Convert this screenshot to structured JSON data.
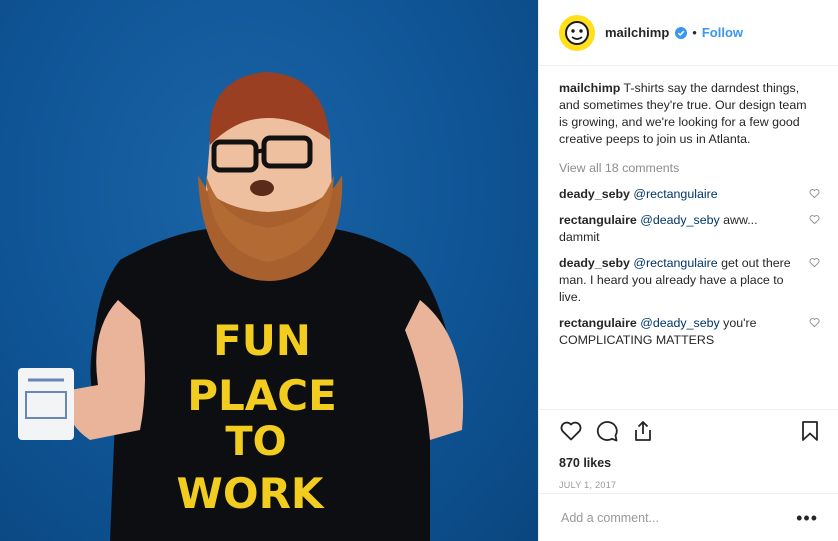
{
  "post": {
    "image": {
      "alt": "Man in black t-shirt holding a mug"
    },
    "shirt_lines": [
      "FUN",
      "PLACE",
      "TO",
      "WORK"
    ]
  },
  "header": {
    "username": "mailchimp",
    "verified_icon": "verified-badge-icon",
    "separator": "•",
    "follow_label": "Follow"
  },
  "caption": {
    "username": "mailchimp",
    "text": "T-shirts say the darndest things, and sometimes they're true. Our design team is growing, and we're looking for a few good creative peeps to join us in Atlanta."
  },
  "view_all_comments": "View all 18 comments",
  "comments": [
    {
      "username": "deady_seby",
      "mention": "@rectangulaire",
      "text": ""
    },
    {
      "username": "rectangulaire",
      "mention": "@deady_seby",
      "text": "aww... dammit"
    },
    {
      "username": "deady_seby",
      "mention": "@rectangulaire",
      "text": "get out there man. I heard you already have a place to live."
    },
    {
      "username": "rectangulaire",
      "mention": "@deady_seby",
      "text": "you're COMPLICATING MATTERS"
    }
  ],
  "actions": {
    "like_icon": "heart-icon",
    "comment_icon": "comment-icon",
    "share_icon": "share-icon",
    "save_icon": "bookmark-icon"
  },
  "likes": "870 likes",
  "date": "JULY 1, 2017",
  "add_comment": {
    "placeholder": "Add a comment...",
    "more_label": "•••"
  },
  "colors": {
    "accent": "#3897f0",
    "brand_yellow": "#ffe01b",
    "mention": "#003569",
    "photo_bg": "#0f5596"
  }
}
